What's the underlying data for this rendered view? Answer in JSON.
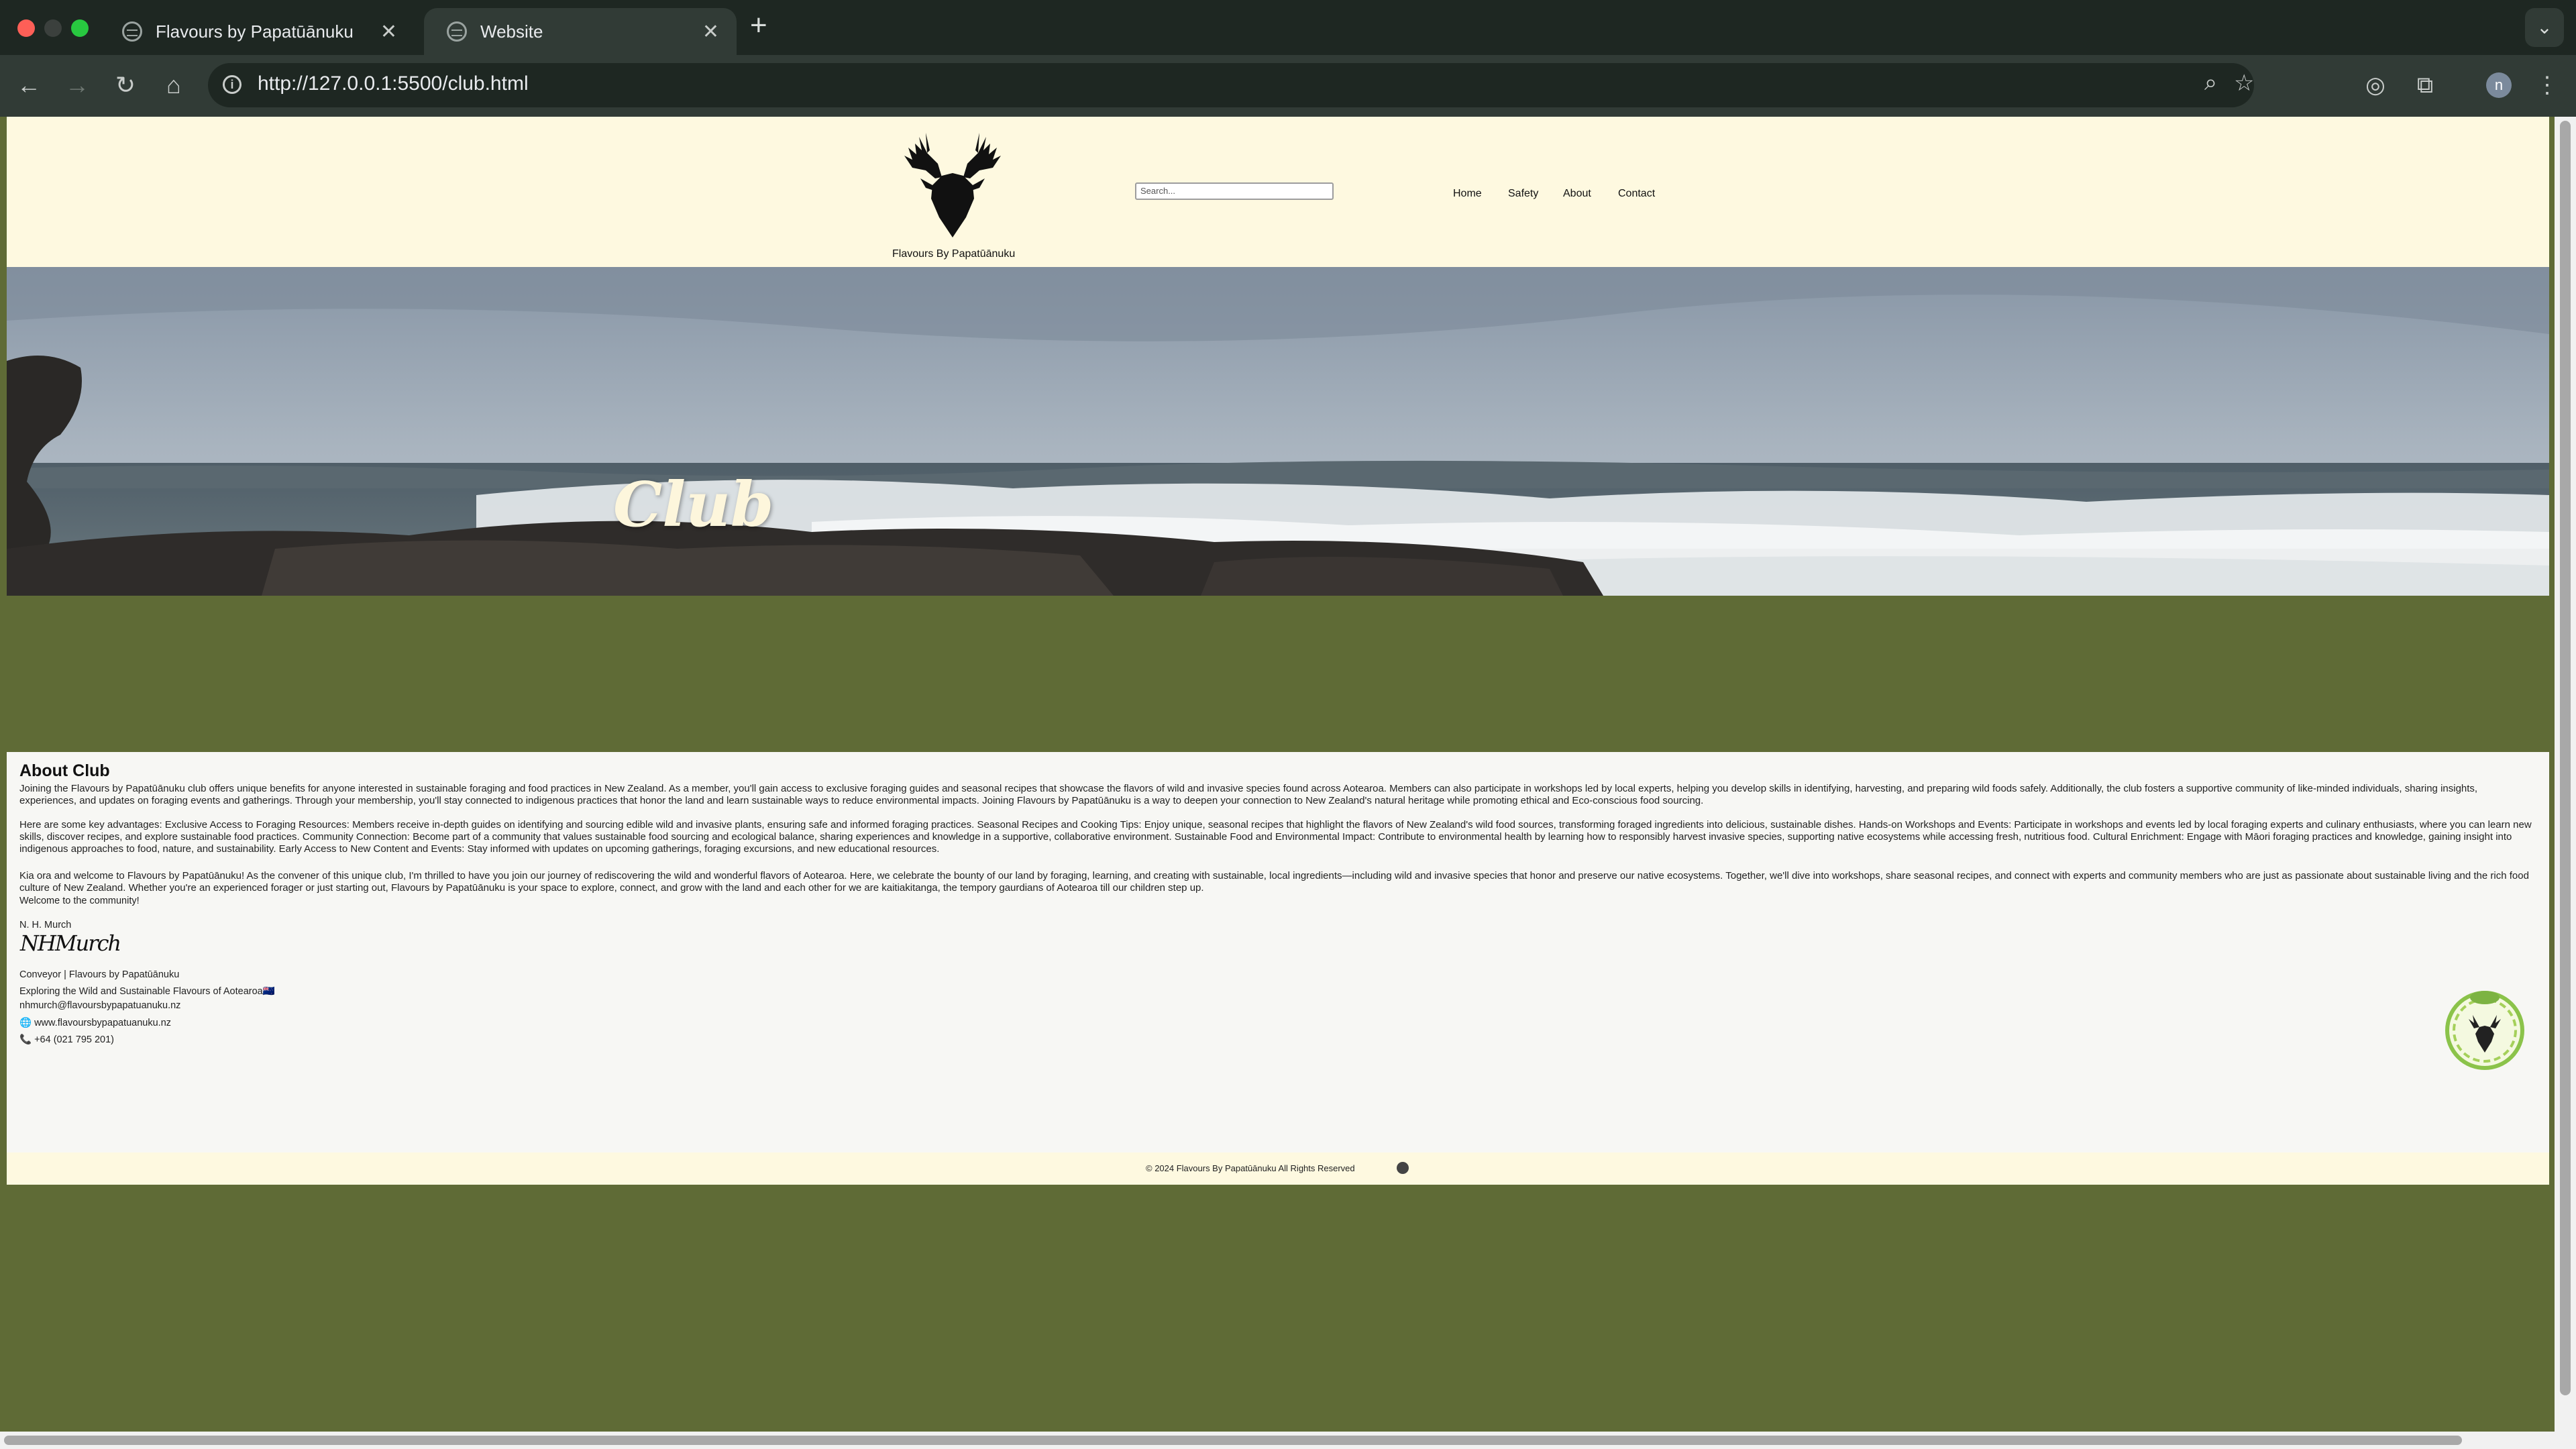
{
  "browser": {
    "tabs": [
      {
        "title": "Flavours by Papatūānuku",
        "active": false
      },
      {
        "title": "Website",
        "active": true
      }
    ],
    "url": "http://127.0.0.1:5500/club.html",
    "profile_initial": "n"
  },
  "site": {
    "brand": "Flavours By Papatūānuku",
    "search_placeholder": "Search...",
    "nav": [
      "Home",
      "Safety",
      "About",
      "Contact"
    ]
  },
  "hero": {
    "title": "Club"
  },
  "about": {
    "heading": "About Club",
    "paragraphs": [
      "Joining the Flavours by Papatūānuku club offers unique benefits for anyone interested in sustainable foraging and food practices in New Zealand. As a member, you'll gain access to exclusive foraging guides and seasonal recipes that showcase the flavors of wild and invasive species found across Aotearoa. Members can also participate in workshops led by local experts, helping you develop skills in identifying, harvesting, and preparing wild foods safely. Additionally, the club fosters a supportive community of like-minded individuals, sharing insights, experiences, and updates on foraging events and gatherings. Through your membership, you'll stay connected to indigenous practices that honor the land and learn sustainable ways to reduce environmental impacts. Joining Flavours by Papatūānuku is a way to deepen your connection to New Zealand's natural heritage while promoting ethical and Eco-conscious food sourcing.",
      "Here are some key advantages: Exclusive Access to Foraging Resources: Members receive in-depth guides on identifying and sourcing edible wild and invasive plants, ensuring safe and informed foraging practices. Seasonal Recipes and Cooking Tips: Enjoy unique, seasonal recipes that highlight the flavors of New Zealand's wild food sources, transforming foraged ingredients into delicious, sustainable dishes. Hands-on Workshops and Events: Participate in workshops and events led by local foraging experts and culinary enthusiasts, where you can learn new skills, discover recipes, and explore sustainable food practices. Community Connection: Become part of a community that values sustainable food sourcing and ecological balance, sharing experiences and knowledge in a supportive, collaborative environment. Sustainable Food and Environmental Impact: Contribute to environmental health by learning how to responsibly harvest invasive species, supporting native ecosystems while accessing fresh, nutritious food. Cultural Enrichment: Engage with Māori foraging practices and knowledge, gaining insight into indigenous approaches to food, nature, and sustainability. Early Access to New Content and Events: Stay informed with updates on upcoming gatherings, foraging excursions, and new educational resources.",
      "Kia ora and welcome to Flavours by Papatūānuku! As the convener of this unique club, I'm thrilled to have you join our journey of rediscovering the wild and wonderful flavors of Aotearoa. Here, we celebrate the bounty of our land by foraging, learning, and creating with sustainable, local ingredients—including wild and invasive species that honor and preserve our native ecosystems. Together, we'll dive into workshops, share seasonal recipes, and connect with experts and community members who are just as passionate about sustainable living and the rich food culture of New Zealand. Whether you're an experienced forager or just starting out, Flavours by Papatūānuku is your space to explore, connect, and grow with the land and each other for we are kaitiakitanga, the tempory gaurdians of Aotearoa till our children step up."
    ],
    "welcome": "Welcome to the community!",
    "signer": "N. H. Murch",
    "signature_script": "NHMurch",
    "role": "Conveyor | Flavours by Papatūānuku",
    "tagline": "Exploring the Wild and Sustainable Flavours of Aotearoa🇳🇿",
    "email": "nhmurch@flavoursbypapatuanuku.nz",
    "website": "🌐 www.flavoursbypapatuanuku.nz",
    "phone": "📞 +64 (021 795 201)"
  },
  "footer": {
    "copyright": "© 2024 Flavours By Papatūānuku All Rights Reserved"
  },
  "colors": {
    "cream": "#fef9e0",
    "olive": "#5f6b36",
    "chrome_dark": "#1e2722",
    "chrome_toolbar": "#313b36"
  }
}
